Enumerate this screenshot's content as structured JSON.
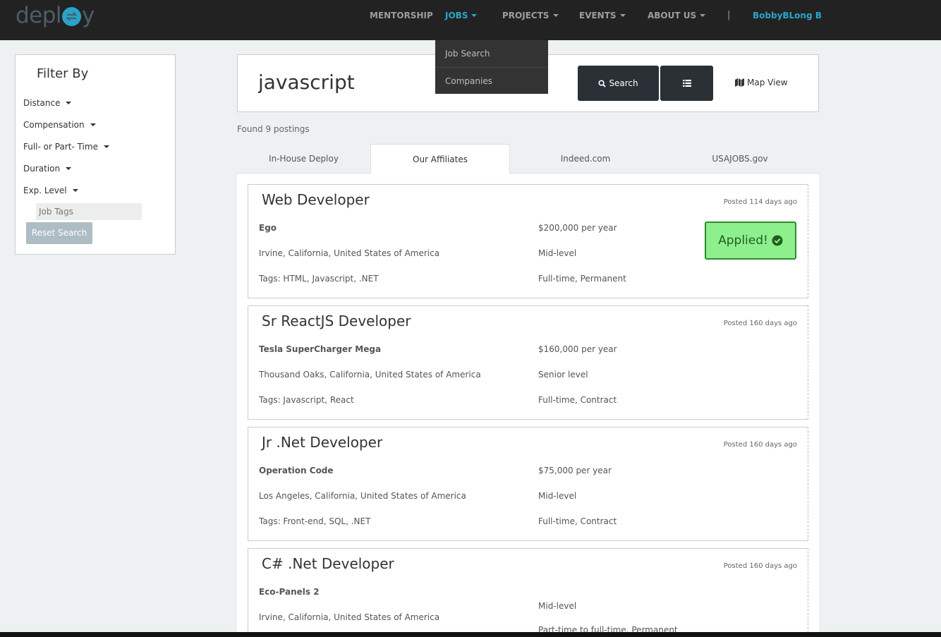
{
  "navbar": {
    "logo_text_start": "depl",
    "logo_text_end": "y",
    "items": [
      {
        "label": "MENTORSHIP"
      },
      {
        "label": "JOBS"
      },
      {
        "label": "PROJECTS"
      },
      {
        "label": "EVENTS"
      },
      {
        "label": "ABOUT US"
      }
    ],
    "separator": "|",
    "user": "BobbyBLong B",
    "active_color": "#2aa6ca"
  },
  "jobs_dropdown": {
    "items": [
      {
        "label": "Job Search"
      },
      {
        "label": "Companies"
      }
    ]
  },
  "filter": {
    "title": "Filter By",
    "items": [
      {
        "label": "Distance"
      },
      {
        "label": "Compensation"
      },
      {
        "label": "Full- or Part- Time"
      },
      {
        "label": "Duration"
      },
      {
        "label": "Exp. Level"
      }
    ],
    "tags_placeholder": "Job Tags",
    "reset_label": "Reset Search"
  },
  "search": {
    "query": "javascript",
    "search_label": "Search",
    "list_icon": "list-icon",
    "map_label": "Map View"
  },
  "results": {
    "found_text": "Found 9 postings"
  },
  "tabs": [
    {
      "label": "In-House Deploy"
    },
    {
      "label": "Our Affiliates"
    },
    {
      "label": "Indeed.com"
    },
    {
      "label": "USAJOBS.gov"
    }
  ],
  "jobs": [
    {
      "title": "Web Developer",
      "posted": "Posted 114 days ago",
      "company": "Ego",
      "location": "Irvine, California, United States of America",
      "tags": "Tags: HTML, Javascript, .NET",
      "salary": "$200,000 per year",
      "level": "Mid-level",
      "type": "Full-time, Permanent",
      "applied_label": "Applied!"
    },
    {
      "title": "Sr ReactJS Developer",
      "posted": "Posted 160 days ago",
      "company": "Tesla SuperCharger Mega",
      "location": "Thousand Oaks, California, United States of America",
      "tags": "Tags: Javascript, React",
      "salary": "$160,000 per year",
      "level": "Senior level",
      "type": "Full-time, Contract"
    },
    {
      "title": "Jr .Net Developer",
      "posted": "Posted 160 days ago",
      "company": "Operation Code",
      "location": "Los Angeles, California, United States of America",
      "tags": "Tags: Front-end, SQL, .NET",
      "salary": "$75,000 per year",
      "level": "Mid-level",
      "type": "Full-time, Contract"
    },
    {
      "title": "C# .Net Developer",
      "posted": "Posted 160 days ago",
      "company": "Eco-Panels 2",
      "location": "Irvine, California, United States of America",
      "level": "Mid-level",
      "type": "Part-time to full-time, Permanent"
    }
  ]
}
